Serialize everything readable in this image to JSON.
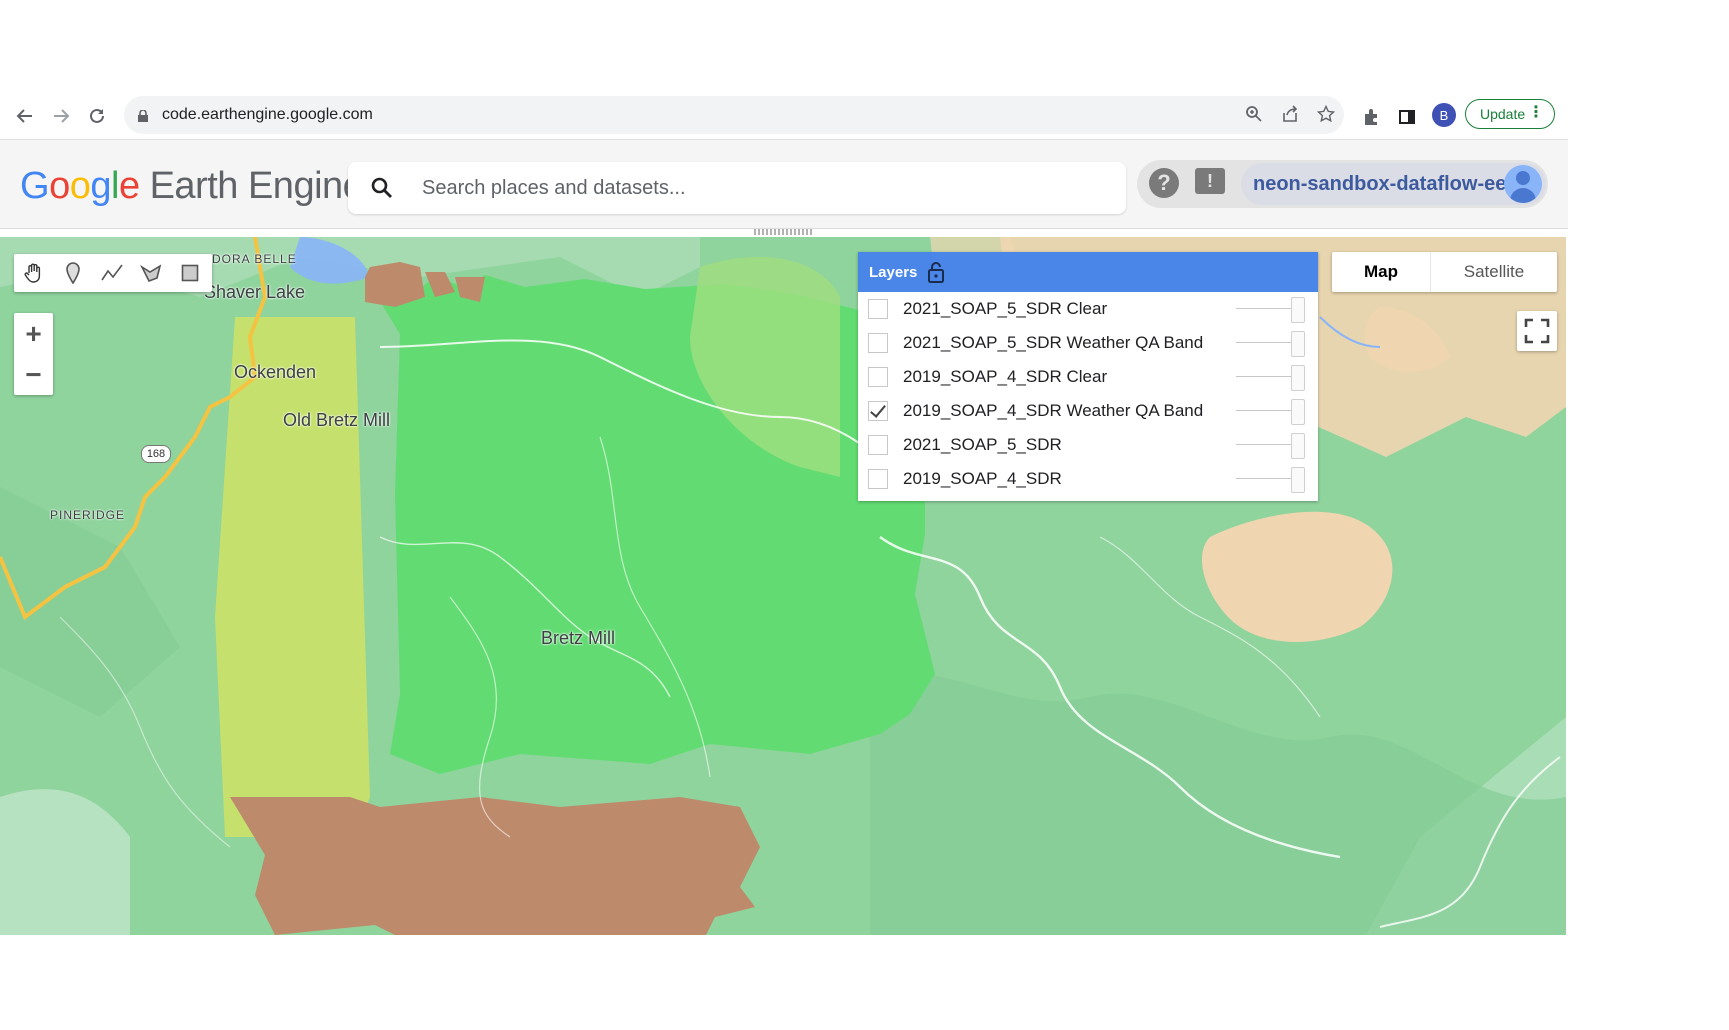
{
  "browser": {
    "url": "code.earthengine.google.com",
    "profile_initial": "B",
    "update_label": "Update"
  },
  "header": {
    "logo_google": "Google",
    "logo_product": "Earth Engine",
    "search_placeholder": "Search places and datasets...",
    "project_name": "neon-sandbox-dataflow-ee"
  },
  "map": {
    "labels": [
      "DORA BELLE",
      "Shaver Lake",
      "Ockenden",
      "Old Bretz Mill",
      "PINERIDGE",
      "Bretz Mill"
    ],
    "route_number": "168",
    "map_type_options": [
      "Map",
      "Satellite"
    ],
    "map_type_selected": "Map",
    "colors": {
      "base_forest": "#8fd39d",
      "layer_green": "#62dc72",
      "layer_yellow": "#c5e06c",
      "layer_brown": "#bd8a6c",
      "sand": "#efd5b0",
      "road": "#f5c342"
    }
  },
  "layers_panel": {
    "title": "Layers",
    "header_color": "#4a86e8",
    "layers": [
      {
        "name": "2021_SOAP_5_SDR Clear",
        "checked": false
      },
      {
        "name": "2021_SOAP_5_SDR Weather QA Band",
        "checked": false
      },
      {
        "name": "2019_SOAP_4_SDR Clear",
        "checked": false
      },
      {
        "name": "2019_SOAP_4_SDR Weather QA Band",
        "checked": true
      },
      {
        "name": "2021_SOAP_5_SDR",
        "checked": false
      },
      {
        "name": "2019_SOAP_4_SDR",
        "checked": false
      }
    ]
  },
  "icons": {
    "drawing_tools": [
      "pan-hand-icon",
      "marker-icon",
      "line-icon",
      "polygon-icon",
      "rectangle-icon"
    ],
    "zoom": [
      "zoom-in-icon",
      "zoom-out-icon"
    ]
  }
}
